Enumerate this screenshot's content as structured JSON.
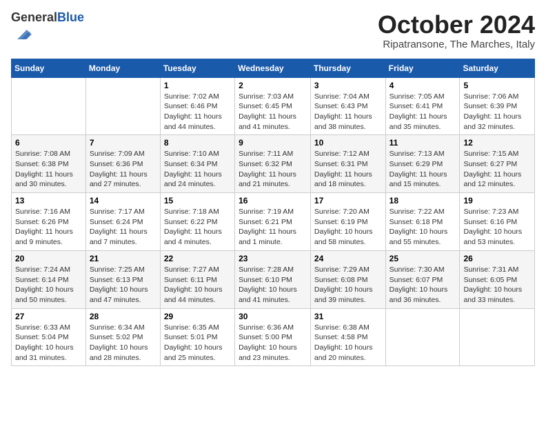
{
  "header": {
    "logo_general": "General",
    "logo_blue": "Blue",
    "month_title": "October 2024",
    "location": "Ripatransone, The Marches, Italy"
  },
  "weekdays": [
    "Sunday",
    "Monday",
    "Tuesday",
    "Wednesday",
    "Thursday",
    "Friday",
    "Saturday"
  ],
  "weeks": [
    [
      {
        "day": "",
        "info": ""
      },
      {
        "day": "",
        "info": ""
      },
      {
        "day": "1",
        "info": "Sunrise: 7:02 AM\nSunset: 6:46 PM\nDaylight: 11 hours and 44 minutes."
      },
      {
        "day": "2",
        "info": "Sunrise: 7:03 AM\nSunset: 6:45 PM\nDaylight: 11 hours and 41 minutes."
      },
      {
        "day": "3",
        "info": "Sunrise: 7:04 AM\nSunset: 6:43 PM\nDaylight: 11 hours and 38 minutes."
      },
      {
        "day": "4",
        "info": "Sunrise: 7:05 AM\nSunset: 6:41 PM\nDaylight: 11 hours and 35 minutes."
      },
      {
        "day": "5",
        "info": "Sunrise: 7:06 AM\nSunset: 6:39 PM\nDaylight: 11 hours and 32 minutes."
      }
    ],
    [
      {
        "day": "6",
        "info": "Sunrise: 7:08 AM\nSunset: 6:38 PM\nDaylight: 11 hours and 30 minutes."
      },
      {
        "day": "7",
        "info": "Sunrise: 7:09 AM\nSunset: 6:36 PM\nDaylight: 11 hours and 27 minutes."
      },
      {
        "day": "8",
        "info": "Sunrise: 7:10 AM\nSunset: 6:34 PM\nDaylight: 11 hours and 24 minutes."
      },
      {
        "day": "9",
        "info": "Sunrise: 7:11 AM\nSunset: 6:32 PM\nDaylight: 11 hours and 21 minutes."
      },
      {
        "day": "10",
        "info": "Sunrise: 7:12 AM\nSunset: 6:31 PM\nDaylight: 11 hours and 18 minutes."
      },
      {
        "day": "11",
        "info": "Sunrise: 7:13 AM\nSunset: 6:29 PM\nDaylight: 11 hours and 15 minutes."
      },
      {
        "day": "12",
        "info": "Sunrise: 7:15 AM\nSunset: 6:27 PM\nDaylight: 11 hours and 12 minutes."
      }
    ],
    [
      {
        "day": "13",
        "info": "Sunrise: 7:16 AM\nSunset: 6:26 PM\nDaylight: 11 hours and 9 minutes."
      },
      {
        "day": "14",
        "info": "Sunrise: 7:17 AM\nSunset: 6:24 PM\nDaylight: 11 hours and 7 minutes."
      },
      {
        "day": "15",
        "info": "Sunrise: 7:18 AM\nSunset: 6:22 PM\nDaylight: 11 hours and 4 minutes."
      },
      {
        "day": "16",
        "info": "Sunrise: 7:19 AM\nSunset: 6:21 PM\nDaylight: 11 hours and 1 minute."
      },
      {
        "day": "17",
        "info": "Sunrise: 7:20 AM\nSunset: 6:19 PM\nDaylight: 10 hours and 58 minutes."
      },
      {
        "day": "18",
        "info": "Sunrise: 7:22 AM\nSunset: 6:18 PM\nDaylight: 10 hours and 55 minutes."
      },
      {
        "day": "19",
        "info": "Sunrise: 7:23 AM\nSunset: 6:16 PM\nDaylight: 10 hours and 53 minutes."
      }
    ],
    [
      {
        "day": "20",
        "info": "Sunrise: 7:24 AM\nSunset: 6:14 PM\nDaylight: 10 hours and 50 minutes."
      },
      {
        "day": "21",
        "info": "Sunrise: 7:25 AM\nSunset: 6:13 PM\nDaylight: 10 hours and 47 minutes."
      },
      {
        "day": "22",
        "info": "Sunrise: 7:27 AM\nSunset: 6:11 PM\nDaylight: 10 hours and 44 minutes."
      },
      {
        "day": "23",
        "info": "Sunrise: 7:28 AM\nSunset: 6:10 PM\nDaylight: 10 hours and 41 minutes."
      },
      {
        "day": "24",
        "info": "Sunrise: 7:29 AM\nSunset: 6:08 PM\nDaylight: 10 hours and 39 minutes."
      },
      {
        "day": "25",
        "info": "Sunrise: 7:30 AM\nSunset: 6:07 PM\nDaylight: 10 hours and 36 minutes."
      },
      {
        "day": "26",
        "info": "Sunrise: 7:31 AM\nSunset: 6:05 PM\nDaylight: 10 hours and 33 minutes."
      }
    ],
    [
      {
        "day": "27",
        "info": "Sunrise: 6:33 AM\nSunset: 5:04 PM\nDaylight: 10 hours and 31 minutes."
      },
      {
        "day": "28",
        "info": "Sunrise: 6:34 AM\nSunset: 5:02 PM\nDaylight: 10 hours and 28 minutes."
      },
      {
        "day": "29",
        "info": "Sunrise: 6:35 AM\nSunset: 5:01 PM\nDaylight: 10 hours and 25 minutes."
      },
      {
        "day": "30",
        "info": "Sunrise: 6:36 AM\nSunset: 5:00 PM\nDaylight: 10 hours and 23 minutes."
      },
      {
        "day": "31",
        "info": "Sunrise: 6:38 AM\nSunset: 4:58 PM\nDaylight: 10 hours and 20 minutes."
      },
      {
        "day": "",
        "info": ""
      },
      {
        "day": "",
        "info": ""
      }
    ]
  ]
}
